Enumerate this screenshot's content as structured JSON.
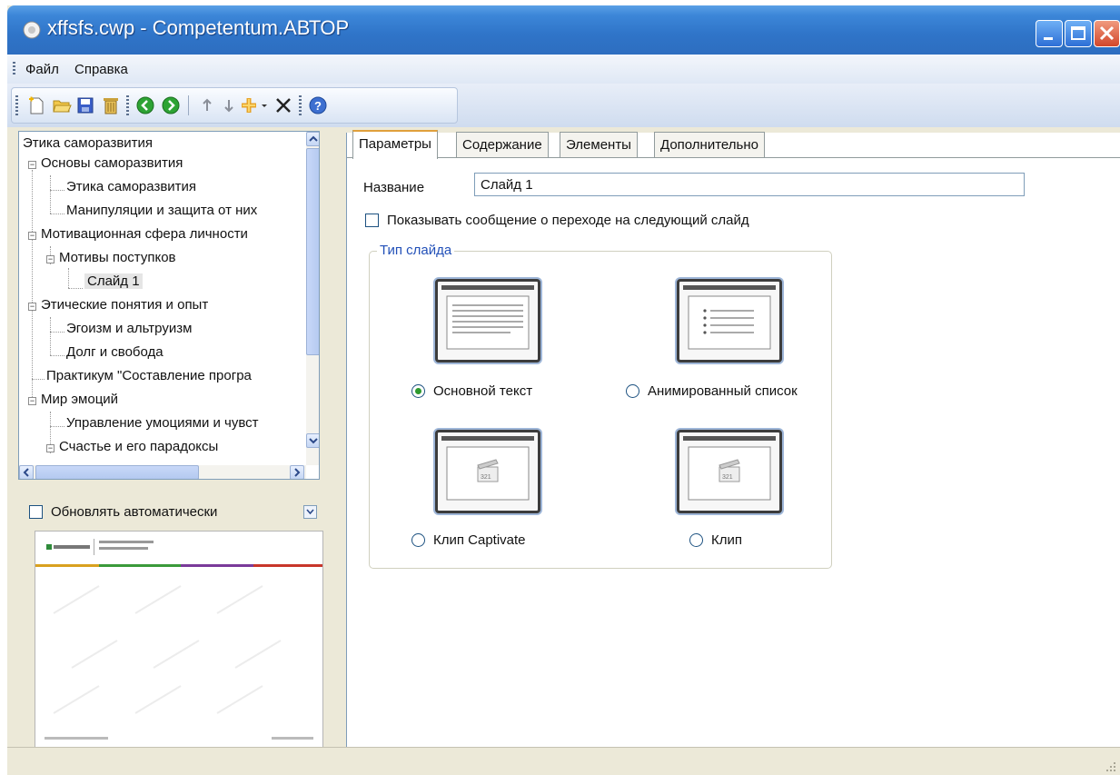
{
  "window": {
    "title": "xffsfs.cwp - Competentum.АВТОР"
  },
  "menu": {
    "items": [
      "Файл",
      "Справка"
    ]
  },
  "toolbar": {
    "icons": [
      "new-icon",
      "open-icon",
      "save-icon",
      "delete-file-icon",
      "back-icon",
      "forward-icon",
      "move-up-icon",
      "move-down-icon",
      "add-icon",
      "remove-icon",
      "help-icon"
    ]
  },
  "tree": {
    "items": [
      "Этика саморазвития",
      "Основы саморазвития",
      "Этика саморазвития",
      "Манипуляции и защита от них",
      "Мотивационная сфера личности",
      "Мотивы поступков",
      "Слайд 1",
      "Этические понятия и опыт",
      "Эгоизм и альтруизм",
      "Долг и свобода",
      "Практикум \"Составление програ",
      "Мир эмоций",
      "Управление умоциями и чувст",
      "Счастье и его парадоксы"
    ]
  },
  "auto_update": {
    "label": "Обновлять автоматически"
  },
  "tabs": [
    "Параметры",
    "Содержание",
    "Элементы",
    "Дополнительно"
  ],
  "form": {
    "name_label": "Название",
    "name_value": "Слайд 1",
    "show_message_label": "Показывать сообщение о переходе на следующий слайд",
    "group_title": "Тип слайда",
    "options": [
      "Основной текст",
      "Анимированный список",
      "Клип Captivate",
      "Клип"
    ],
    "selected_option": "Основной текст",
    "clip_badge": "321"
  }
}
